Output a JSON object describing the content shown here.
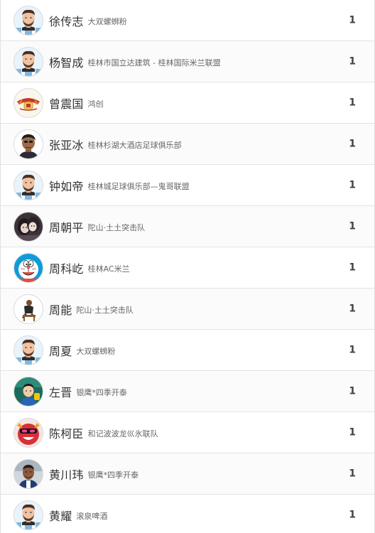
{
  "rows": [
    {
      "name": "徐传志",
      "team": "大双螺蛳粉",
      "count": "1",
      "avatar": "messi"
    },
    {
      "name": "杨智成",
      "team": "桂林市国立达建筑 - 桂林国际米兰联盟",
      "count": "1",
      "avatar": "messi"
    },
    {
      "name": "曾震国",
      "team": "鸿创",
      "count": "1",
      "avatar": "badge-red"
    },
    {
      "name": "张亚冰",
      "team": "桂林杉湖大酒店足球俱乐部",
      "count": "1",
      "avatar": "person-photo"
    },
    {
      "name": "钟如帝",
      "team": "桂林城足球俱乐部—鬼哥联盟",
      "count": "1",
      "avatar": "messi"
    },
    {
      "name": "周朝平",
      "team": "陀山·土土突击队",
      "count": "1",
      "avatar": "couple-photo"
    },
    {
      "name": "周科屹",
      "team": "桂林AC米兰",
      "count": "1",
      "avatar": "doraemon"
    },
    {
      "name": "周能",
      "team": "陀山·土土突击队",
      "count": "1",
      "avatar": "sitting-figure"
    },
    {
      "name": "周夏",
      "team": "大双螺蛳粉",
      "count": "1",
      "avatar": "messi"
    },
    {
      "name": "左晋",
      "team": "银鹰*四季开泰",
      "count": "1",
      "avatar": "kid-photo"
    },
    {
      "name": "陈柯臣",
      "team": "和记波波龙巛氷联队",
      "count": "1",
      "avatar": "cartoon-red"
    },
    {
      "name": "黄川玮",
      "team": "银鹰*四季开泰",
      "count": "1",
      "avatar": "player-photo"
    },
    {
      "name": "黄耀",
      "team": "滚泉啤酒",
      "count": "1",
      "avatar": "messi"
    }
  ],
  "colors": {
    "row_border": "#e3e3e3",
    "name_text": "#333333",
    "team_text": "#666666",
    "count_text": "#444444"
  }
}
